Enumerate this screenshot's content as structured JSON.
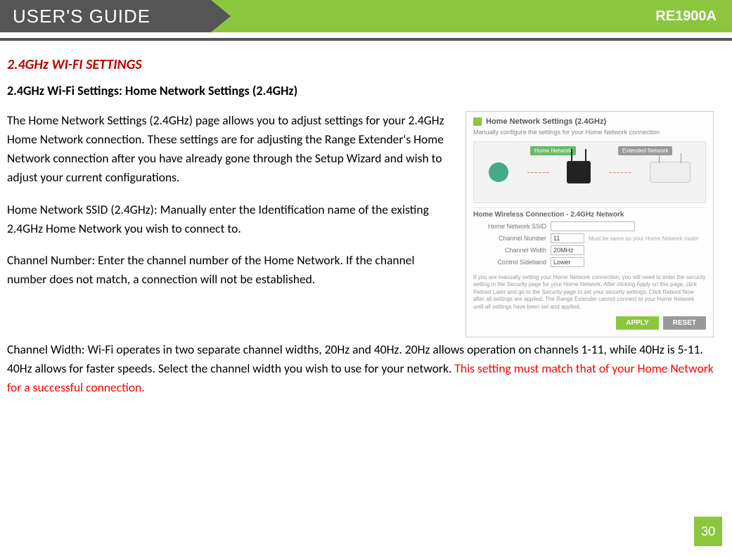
{
  "header": {
    "title": "USER'S GUIDE",
    "model": "RE1900A"
  },
  "section_heading": "2.4GHz WI-FI SETTINGS",
  "sub_heading": "2.4GHz Wi-Fi Settings: Home Network Settings (2.4GHz)",
  "paragraphs": {
    "p1": "The Home Network Settings (2.4GHz) page allows you to adjust settings for your 2.4GHz Home Network connection. These settings are for adjusting the Range Extender's Home Network connection after you have already gone through the Setup Wizard and wish to adjust your current configurations.",
    "p2": "Home Network SSID (2.4GHz): Manually enter the Identification name of the existing 2.4GHz Home Network you wish to connect to.",
    "p3": "Channel Number: Enter the channel number of the Home Network. If the channel number does not match, a connection will not be established.",
    "p4a": "Channel Width: Wi-Fi operates in two separate channel widths, 20Hz and 40Hz. 20Hz allows operation on channels 1-11, while 40Hz is 5-11. 40Hz allows for faster speeds. Select the channel width you wish to use for your network. ",
    "p4b": "This setting must match that of your Home Network for a successful connection."
  },
  "screenshot": {
    "title": "Home Network Settings (2.4GHz)",
    "subtitle": "Manually configure the settings for your Home Network connection",
    "banner_home": "Home Network",
    "banner_ext": "Extended Network",
    "section_label": "Home Wireless Connection - 2.4GHz Network",
    "fields": {
      "ssid_label": "Home Network SSID",
      "ssid_value": "",
      "channel_label": "Channel Number",
      "channel_value": "11",
      "channel_hint": "Must be same as your Home Network router",
      "width_label": "Channel Width",
      "width_value": "20MHz",
      "sideband_label": "Control Sideband",
      "sideband_value": "Lower"
    },
    "note": "If you are manually setting your Home Network connection, you will need to enter the security setting in the Security page for your Home Network. After clicking Apply on this page, click Reboot Later and go to the Security page to set your security settings. Click Reboot Now after all settings are applied. The Range Extender cannot connect to your Home Network until all settings have been set and applied.",
    "buttons": {
      "apply": "APPLY",
      "reset": "RESET"
    }
  },
  "page_number": "30"
}
